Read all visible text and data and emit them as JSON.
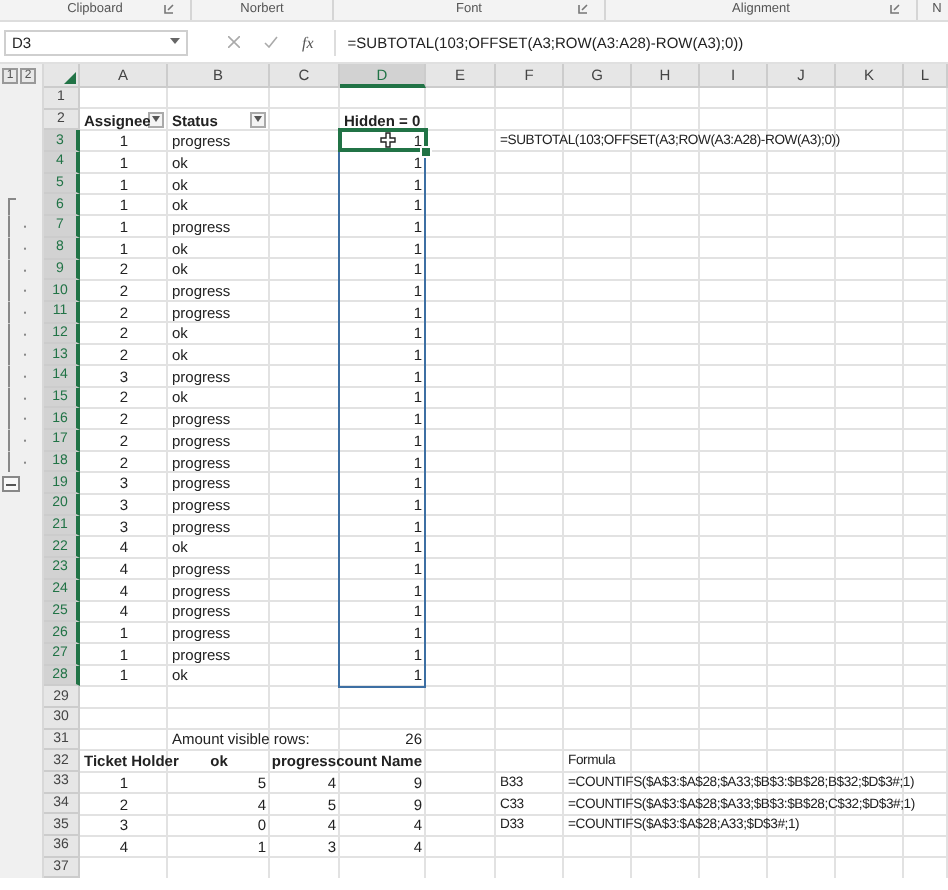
{
  "ribbon": {
    "groups": [
      {
        "label": "Clipboard",
        "launcher": true
      },
      {
        "label": "Norbert",
        "launcher": false
      },
      {
        "label": "Font",
        "launcher": true
      },
      {
        "label": "Alignment",
        "launcher": true
      },
      {
        "label": "N",
        "launcher": false
      }
    ]
  },
  "formula_bar": {
    "name_box": "D3",
    "fx_label": "fx",
    "formula": "=SUBTOTAL(103;OFFSET(A3;ROW(A3:A28)-ROW(A3);0))"
  },
  "outline_levels": [
    "1",
    "2"
  ],
  "columns": [
    {
      "label": "A",
      "selected": false
    },
    {
      "label": "B",
      "selected": false
    },
    {
      "label": "C",
      "selected": false
    },
    {
      "label": "D",
      "selected": true
    },
    {
      "label": "E",
      "selected": false
    },
    {
      "label": "F",
      "selected": false
    },
    {
      "label": "G",
      "selected": false
    },
    {
      "label": "H",
      "selected": false
    },
    {
      "label": "I",
      "selected": false
    },
    {
      "label": "J",
      "selected": false
    },
    {
      "label": "K",
      "selected": false
    },
    {
      "label": "L",
      "selected": false
    }
  ],
  "rows": [
    {
      "number": "1",
      "kind": "blank",
      "cells": {},
      "selected": false,
      "active": false,
      "grouped": false
    },
    {
      "number": "2",
      "kind": "header",
      "cells": {
        "A": "Assignee",
        "B": "Status",
        "D": "Hidden = 0"
      },
      "filters": {
        "A": true,
        "B": true
      },
      "selected": false,
      "active": false,
      "grouped": false
    },
    {
      "number": "3",
      "kind": "data",
      "cells": {
        "A": "1",
        "B": "progress",
        "D": "1",
        "F": "=SUBTOTAL(103;OFFSET(A3;ROW(A3:A28)-ROW(A3);0))"
      },
      "selected": true,
      "active": true,
      "grouped": false
    },
    {
      "number": "4",
      "kind": "data",
      "cells": {
        "A": "1",
        "B": "ok",
        "D": "1"
      },
      "selected": true,
      "active": false,
      "grouped": false
    },
    {
      "number": "5",
      "kind": "data",
      "cells": {
        "A": "1",
        "B": "ok",
        "D": "1"
      },
      "selected": true,
      "active": false,
      "grouped": false
    },
    {
      "number": "6",
      "kind": "data",
      "cells": {
        "A": "1",
        "B": "ok",
        "D": "1"
      },
      "selected": true,
      "active": false,
      "grouped": true
    },
    {
      "number": "7",
      "kind": "data",
      "cells": {
        "A": "1",
        "B": "progress",
        "D": "1"
      },
      "selected": true,
      "active": false,
      "grouped": true
    },
    {
      "number": "8",
      "kind": "data",
      "cells": {
        "A": "1",
        "B": "ok",
        "D": "1"
      },
      "selected": true,
      "active": false,
      "grouped": true
    },
    {
      "number": "9",
      "kind": "data",
      "cells": {
        "A": "2",
        "B": "ok",
        "D": "1"
      },
      "selected": true,
      "active": false,
      "grouped": true
    },
    {
      "number": "10",
      "kind": "data",
      "cells": {
        "A": "2",
        "B": "progress",
        "D": "1"
      },
      "selected": true,
      "active": false,
      "grouped": true
    },
    {
      "number": "11",
      "kind": "data",
      "cells": {
        "A": "2",
        "B": "progress",
        "D": "1"
      },
      "selected": true,
      "active": false,
      "grouped": true
    },
    {
      "number": "12",
      "kind": "data",
      "cells": {
        "A": "2",
        "B": "ok",
        "D": "1"
      },
      "selected": true,
      "active": false,
      "grouped": true
    },
    {
      "number": "13",
      "kind": "data",
      "cells": {
        "A": "2",
        "B": "ok",
        "D": "1"
      },
      "selected": true,
      "active": false,
      "grouped": true
    },
    {
      "number": "14",
      "kind": "data",
      "cells": {
        "A": "3",
        "B": "progress",
        "D": "1"
      },
      "selected": true,
      "active": false,
      "grouped": true
    },
    {
      "number": "15",
      "kind": "data",
      "cells": {
        "A": "2",
        "B": "ok",
        "D": "1"
      },
      "selected": true,
      "active": false,
      "grouped": true
    },
    {
      "number": "16",
      "kind": "data",
      "cells": {
        "A": "2",
        "B": "progress",
        "D": "1"
      },
      "selected": true,
      "active": false,
      "grouped": true
    },
    {
      "number": "17",
      "kind": "data",
      "cells": {
        "A": "2",
        "B": "progress",
        "D": "1"
      },
      "selected": true,
      "active": false,
      "grouped": true
    },
    {
      "number": "18",
      "kind": "data",
      "cells": {
        "A": "2",
        "B": "progress",
        "D": "1"
      },
      "selected": true,
      "active": false,
      "grouped": true
    },
    {
      "number": "19",
      "kind": "data",
      "cells": {
        "A": "3",
        "B": "progress",
        "D": "1"
      },
      "selected": true,
      "active": false,
      "grouped": true
    },
    {
      "number": "20",
      "kind": "data",
      "cells": {
        "A": "3",
        "B": "progress",
        "D": "1"
      },
      "selected": true,
      "active": false,
      "grouped": false
    },
    {
      "number": "21",
      "kind": "data",
      "cells": {
        "A": "3",
        "B": "progress",
        "D": "1"
      },
      "selected": true,
      "active": false,
      "grouped": false
    },
    {
      "number": "22",
      "kind": "data",
      "cells": {
        "A": "4",
        "B": "ok",
        "D": "1"
      },
      "selected": true,
      "active": false,
      "grouped": false
    },
    {
      "number": "23",
      "kind": "data",
      "cells": {
        "A": "4",
        "B": "progress",
        "D": "1"
      },
      "selected": true,
      "active": false,
      "grouped": false
    },
    {
      "number": "24",
      "kind": "data",
      "cells": {
        "A": "4",
        "B": "progress",
        "D": "1"
      },
      "selected": true,
      "active": false,
      "grouped": false
    },
    {
      "number": "25",
      "kind": "data",
      "cells": {
        "A": "4",
        "B": "progress",
        "D": "1"
      },
      "selected": true,
      "active": false,
      "grouped": false
    },
    {
      "number": "26",
      "kind": "data",
      "cells": {
        "A": "1",
        "B": "progress",
        "D": "1"
      },
      "selected": true,
      "active": false,
      "grouped": false
    },
    {
      "number": "27",
      "kind": "data",
      "cells": {
        "A": "1",
        "B": "progress",
        "D": "1"
      },
      "selected": true,
      "active": false,
      "grouped": false
    },
    {
      "number": "28",
      "kind": "data",
      "cells": {
        "A": "1",
        "B": "ok",
        "D": "1"
      },
      "selected": true,
      "active": false,
      "grouped": false
    },
    {
      "number": "29",
      "kind": "blank",
      "cells": {},
      "selected": false,
      "active": false,
      "grouped": false
    },
    {
      "number": "30",
      "kind": "blank",
      "cells": {},
      "selected": false,
      "active": false,
      "grouped": false
    },
    {
      "number": "31",
      "kind": "note",
      "cells": {
        "B": "Amount visible rows:",
        "D": "26"
      },
      "selected": false,
      "active": false,
      "grouped": false
    },
    {
      "number": "32",
      "kind": "table-header",
      "cells": {
        "A": "Ticket Holder",
        "B": "ok",
        "C": "progress",
        "D": "count Name",
        "G": "Formula"
      },
      "selected": false,
      "active": false,
      "grouped": false
    },
    {
      "number": "33",
      "kind": "summary",
      "cells": {
        "A": "1",
        "B": "5",
        "C": "4",
        "D": "9",
        "F": "B33",
        "G": "=COUNTIFS($A$3:$A$28;$A33;$B$3:$B$28;B$32;$D$3#;1)"
      },
      "selected": false,
      "active": false,
      "grouped": false
    },
    {
      "number": "34",
      "kind": "summary",
      "cells": {
        "A": "2",
        "B": "4",
        "C": "5",
        "D": "9",
        "F": "C33",
        "G": "=COUNTIFS($A$3:$A$28;$A33;$B$3:$B$28;C$32;$D$3#;1)"
      },
      "selected": false,
      "active": false,
      "grouped": false
    },
    {
      "number": "35",
      "kind": "summary",
      "cells": {
        "A": "3",
        "B": "0",
        "C": "4",
        "D": "4",
        "F": "D33",
        "G": "=COUNTIFS($A$3:$A$28;A33;$D$3#;1)"
      },
      "selected": false,
      "active": false,
      "grouped": false
    },
    {
      "number": "36",
      "kind": "summary",
      "cells": {
        "A": "4",
        "B": "1",
        "C": "3",
        "D": "4"
      },
      "selected": false,
      "active": false,
      "grouped": false
    },
    {
      "number": "37",
      "kind": "blank",
      "cells": {},
      "selected": false,
      "active": false,
      "grouped": false
    }
  ]
}
